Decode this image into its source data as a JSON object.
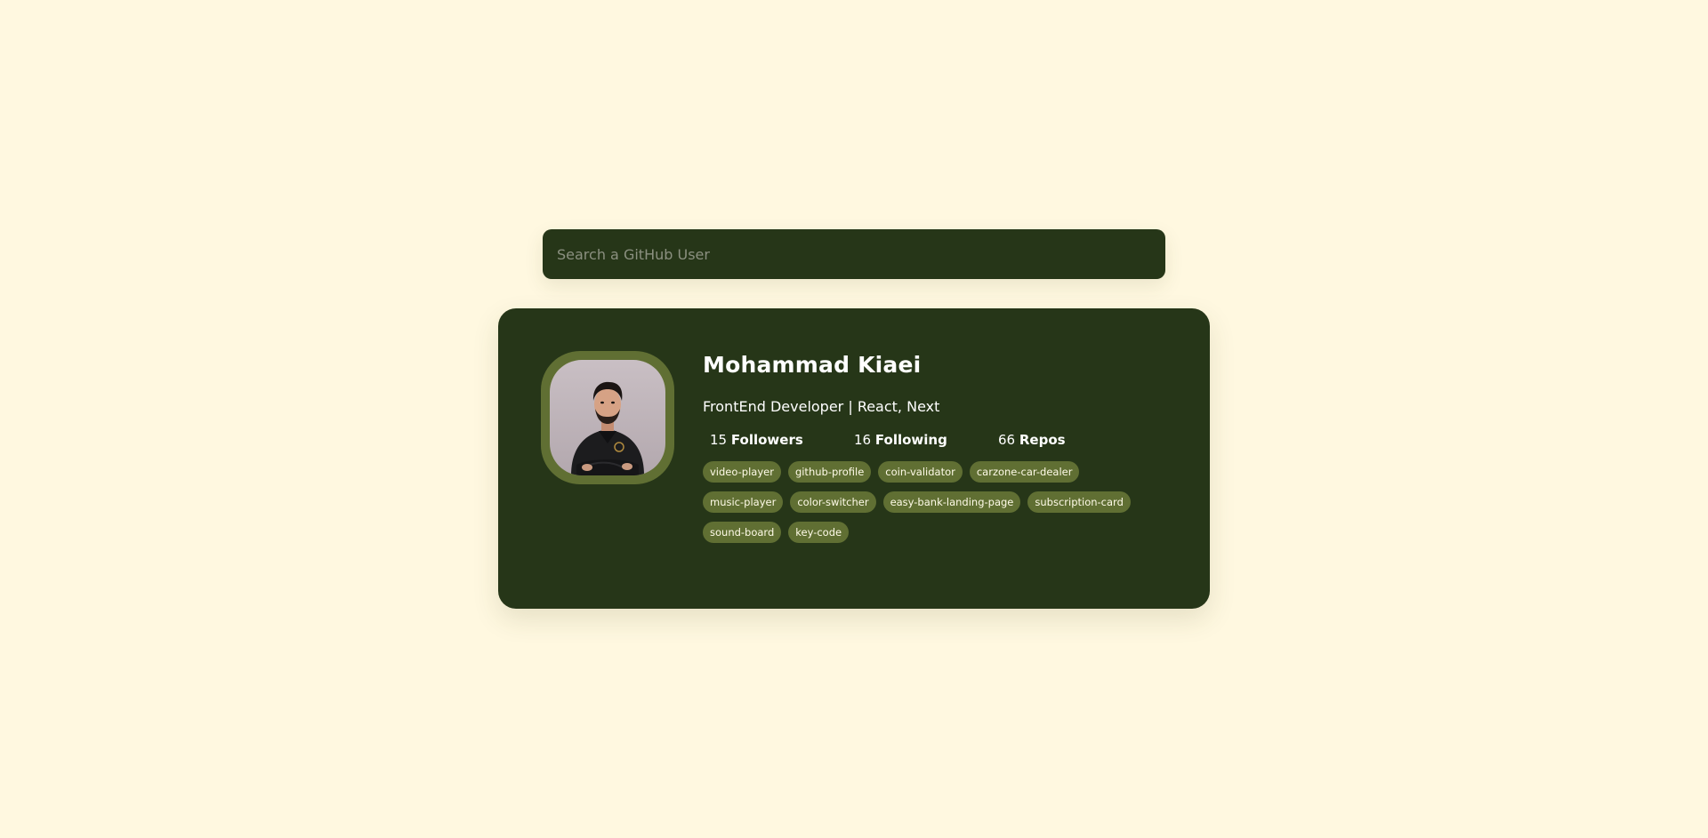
{
  "search": {
    "placeholder": "Search a GitHub User",
    "value": ""
  },
  "profile": {
    "name": "Mohammad Kiaei",
    "bio": "FrontEnd Developer | React, Next",
    "stats": [
      {
        "count": "15",
        "label": "Followers"
      },
      {
        "count": "16",
        "label": "Following"
      },
      {
        "count": "66",
        "label": "Repos"
      }
    ],
    "repos": [
      "video-player",
      "github-profile",
      "coin-validator",
      "carzone-car-dealer",
      "music-player",
      "color-switcher",
      "easy-bank-landing-page",
      "subscription-card",
      "sound-board",
      "key-code"
    ],
    "avatar_icon": "user-photo-icon"
  },
  "colors": {
    "background": "#fff8e0",
    "card": "#263618",
    "accent": "#606f33",
    "text": "#ffffff"
  }
}
